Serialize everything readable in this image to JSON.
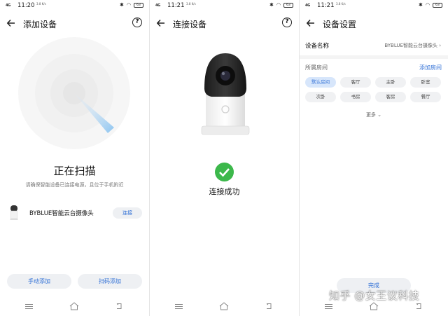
{
  "screen1": {
    "status": {
      "network": "4G",
      "time": "11:20",
      "speed": "3.8 K/s",
      "battery": "63"
    },
    "header": {
      "title": "添加设备",
      "help": "?"
    },
    "scan_title": "正在扫描",
    "scan_subtitle": "请确保智能设备已连接电源，且位于手机附近",
    "device": {
      "name": "BYBLUE智能云台摄像头",
      "connect_label": "连接"
    },
    "buttons": {
      "manual": "手动添加",
      "scan": "扫码添加"
    }
  },
  "screen2": {
    "status": {
      "network": "4G",
      "time": "11:21",
      "speed": "3.8 K/s",
      "battery": "63"
    },
    "header": {
      "title": "连接设备",
      "help": "?"
    },
    "success_text": "连接成功"
  },
  "screen3": {
    "status": {
      "network": "4G",
      "time": "11:21",
      "speed": "3.8 K/s",
      "battery": "63"
    },
    "header": {
      "title": "设备设置"
    },
    "device_name_label": "设备名称",
    "device_name_value": "BYBLUE智能云台摄像头",
    "room_label": "所属房间",
    "add_room": "添加房间",
    "rooms": [
      "默认房间",
      "客厅",
      "主卧",
      "卧室",
      "次卧",
      "书房",
      "客房",
      "餐厅"
    ],
    "selected_room": "默认房间",
    "more": "更多",
    "done": "完成"
  },
  "watermark": "知乎 @女王议科技",
  "colors": {
    "accent": "#2f6fd6",
    "success": "#3cb84b"
  }
}
